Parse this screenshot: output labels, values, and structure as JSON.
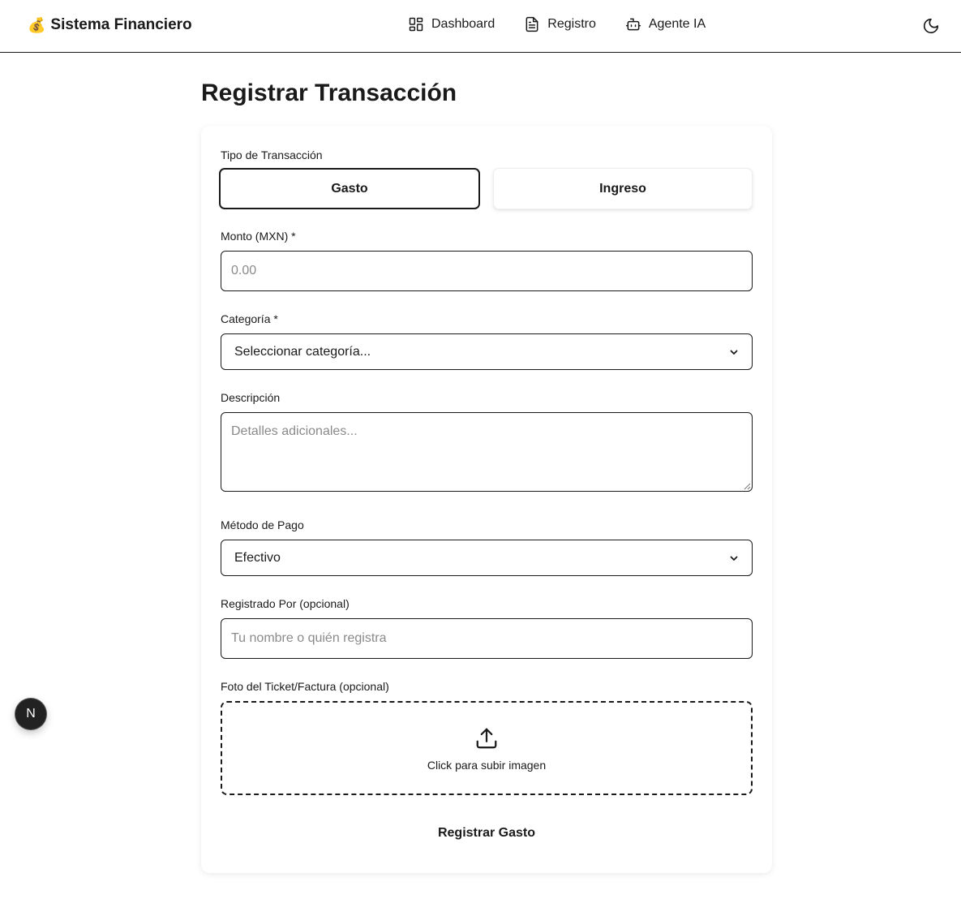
{
  "nav": {
    "brand_emoji": "💰",
    "brand": "Sistema Financiero",
    "links": [
      {
        "label": "Dashboard",
        "icon": "dashboard-grid-icon"
      },
      {
        "label": "Registro",
        "icon": "document-icon"
      },
      {
        "label": "Agente IA",
        "icon": "robot-icon"
      }
    ],
    "theme_icon": "moon-icon"
  },
  "page": {
    "title": "Registrar Transacción"
  },
  "form": {
    "type_label": "Tipo de Transacción",
    "type_options": [
      "Gasto",
      "Ingreso"
    ],
    "selected_type": "Gasto",
    "amount_label": "Monto (MXN) *",
    "amount_placeholder": "0.00",
    "category_label": "Categoría *",
    "category_value": "Seleccionar categoría...",
    "description_label": "Descripción",
    "description_placeholder": "Detalles adicionales...",
    "payment_label": "Método de Pago",
    "payment_value": "Efectivo",
    "registered_by_label": "Registrado Por (opcional)",
    "registered_by_placeholder": "Tu nombre o quién registra",
    "photo_label": "Foto del Ticket/Factura (opcional)",
    "upload_text": "Click para subir imagen",
    "submit_label": "Registrar Gasto"
  },
  "dev_badge": {
    "letter": "N"
  },
  "colors": {
    "text": "#1a1a1a",
    "border": "#1a1a1a",
    "placeholder": "#8a8a8a",
    "badge_bg": "#222222"
  }
}
